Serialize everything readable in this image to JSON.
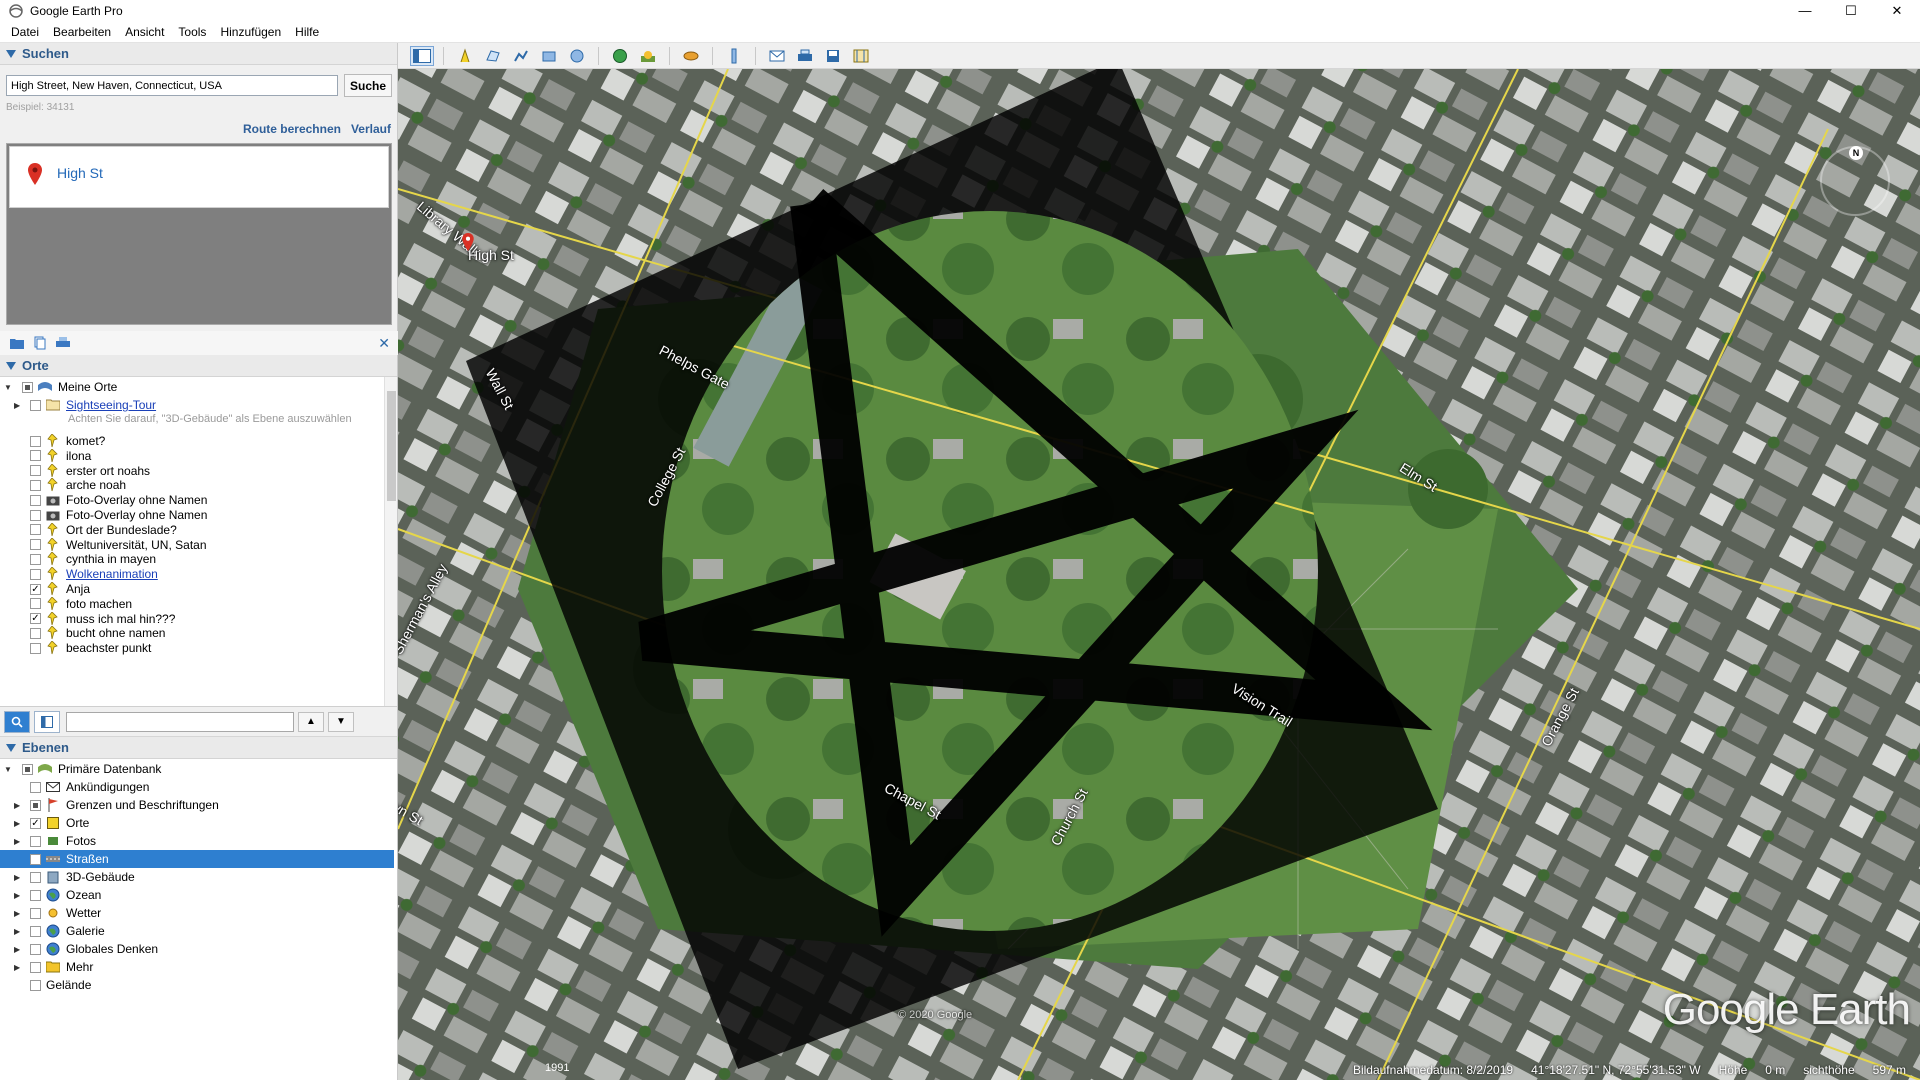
{
  "window": {
    "title": "Google Earth Pro",
    "controls": [
      "—",
      "☐",
      "✕"
    ]
  },
  "menu": [
    "Datei",
    "Bearbeiten",
    "Ansicht",
    "Tools",
    "Hinzufügen",
    "Hilfe"
  ],
  "search": {
    "header": "Suchen",
    "query": "High Street, New Haven, Connecticut, USA",
    "button": "Suche",
    "hint": "Beispiel: 34131",
    "route_link": "Route berechnen",
    "history_link": "Verlauf",
    "result": "High St"
  },
  "places": {
    "header": "Orte",
    "root": "Meine Orte",
    "tour": "Sightseeing-Tour",
    "tour_note": "Achten Sie darauf, \"3D-Gebäude\" als Ebene auszuwählen",
    "items": [
      {
        "label": "komet?",
        "checked": false,
        "icon": "pushpin"
      },
      {
        "label": "ilona",
        "checked": false,
        "icon": "pushpin"
      },
      {
        "label": "erster ort noahs",
        "checked": false,
        "icon": "pushpin"
      },
      {
        "label": "arche noah",
        "checked": false,
        "icon": "pushpin"
      },
      {
        "label": "Foto-Overlay ohne Namen",
        "checked": false,
        "icon": "camera"
      },
      {
        "label": "Foto-Overlay ohne Namen",
        "checked": false,
        "icon": "camera"
      },
      {
        "label": "Ort der Bundeslade?",
        "checked": false,
        "icon": "pushpin"
      },
      {
        "label": "Weltuniversität, UN, Satan",
        "checked": false,
        "icon": "pushpin"
      },
      {
        "label": "cynthia in mayen",
        "checked": false,
        "icon": "pushpin"
      },
      {
        "label": "Wolkenanimation",
        "checked": false,
        "icon": "pushpin",
        "link": true
      },
      {
        "label": "Anja",
        "checked": true,
        "icon": "pushpin"
      },
      {
        "label": "foto machen",
        "checked": false,
        "icon": "pushpin"
      },
      {
        "label": "muss ich mal hin???",
        "checked": true,
        "icon": "pushpin"
      },
      {
        "label": "bucht ohne namen",
        "checked": false,
        "icon": "pushpin"
      },
      {
        "label": "beachster punkt",
        "checked": false,
        "icon": "pushpin"
      }
    ]
  },
  "layers": {
    "header": "Ebenen",
    "root": "Primäre Datenbank",
    "items": [
      {
        "label": "Ankündigungen",
        "checked": false,
        "icon": "envelope",
        "expandable": false
      },
      {
        "label": "Grenzen und Beschriftungen",
        "checked": "partial",
        "icon": "flag",
        "expandable": true
      },
      {
        "label": "Orte",
        "checked": true,
        "icon": "square",
        "expandable": true
      },
      {
        "label": "Fotos",
        "checked": false,
        "icon": "photo",
        "expandable": true
      },
      {
        "label": "Straßen",
        "checked": true,
        "icon": "road",
        "expandable": false,
        "selected": true
      },
      {
        "label": "3D-Gebäude",
        "checked": false,
        "icon": "building",
        "expandable": true
      },
      {
        "label": "Ozean",
        "checked": false,
        "icon": "globe",
        "expandable": true
      },
      {
        "label": "Wetter",
        "checked": false,
        "icon": "sun",
        "expandable": true
      },
      {
        "label": "Galerie",
        "checked": false,
        "icon": "globe",
        "expandable": true
      },
      {
        "label": "Globales Denken",
        "checked": false,
        "icon": "globe",
        "expandable": true
      },
      {
        "label": "Mehr",
        "checked": false,
        "icon": "folder",
        "expandable": true
      }
    ],
    "terrain": "Gelände"
  },
  "map": {
    "street_labels": [
      "Library Walk",
      "High St",
      "Phelps Gate",
      "College St",
      "Elm St",
      "Chapel St",
      "Church St",
      "Orange St",
      "Vision Trail",
      "Sherman's Alley",
      "Crown St",
      "Wall St"
    ],
    "brand": "Google Earth",
    "year": "1991",
    "compass": "N",
    "copyright": "© 2020 Google",
    "status": {
      "date": "Bildaufnahmedatum: 8/2/2019",
      "coords": "41°18'27.51\" N,  72°55'31.53\" W",
      "elevation_label": "Höhe",
      "elevation": "0 m",
      "eye_label": "sichthöhe",
      "eye": "597 m"
    }
  },
  "colors": {
    "accent": "#2e7fd0",
    "header_text": "#2e5a8a",
    "link": "#1a40b8",
    "pin_red": "#d93025"
  }
}
